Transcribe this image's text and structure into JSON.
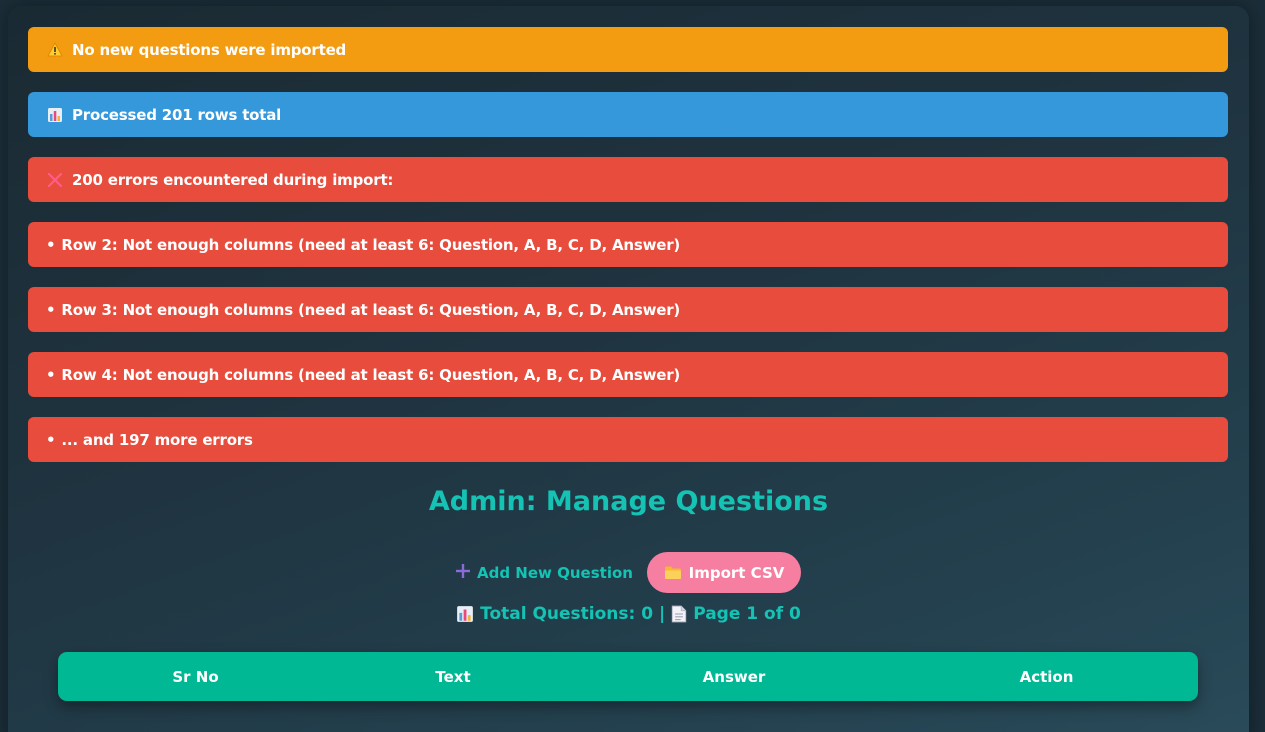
{
  "alerts": {
    "warning": {
      "icon": "warning-icon",
      "text": "No new questions were imported"
    },
    "info": {
      "icon": "bar-chart-icon",
      "text": "Processed 201 rows total"
    },
    "error_summary": {
      "icon": "cross-icon",
      "text": "200 errors encountered during import:"
    },
    "errors": [
      "Row 2: Not enough columns (need at least 6: Question, A, B, C, D, Answer)",
      "Row 3: Not enough columns (need at least 6: Question, A, B, C, D, Answer)",
      "Row 4: Not enough columns (need at least 6: Question, A, B, C, D, Answer)",
      "... and 197 more errors"
    ],
    "bullet": "•"
  },
  "page": {
    "title": "Admin: Manage Questions"
  },
  "actions": {
    "add_label": "Add New Question",
    "add_icon": "plus-icon",
    "import_label": "Import CSV",
    "import_icon": "folder-icon"
  },
  "stats": {
    "total_label": "Total Questions: 0 |",
    "page_label": "Page 1 of 0"
  },
  "table": {
    "headers": [
      "Sr No",
      "Text",
      "Answer",
      "Action"
    ]
  },
  "colors": {
    "warning": "#f39c12",
    "info": "#3498db",
    "error": "#e74c3c",
    "accent": "#14c3b4",
    "import_button": "#f67ea0",
    "table_header": "#00b894"
  }
}
